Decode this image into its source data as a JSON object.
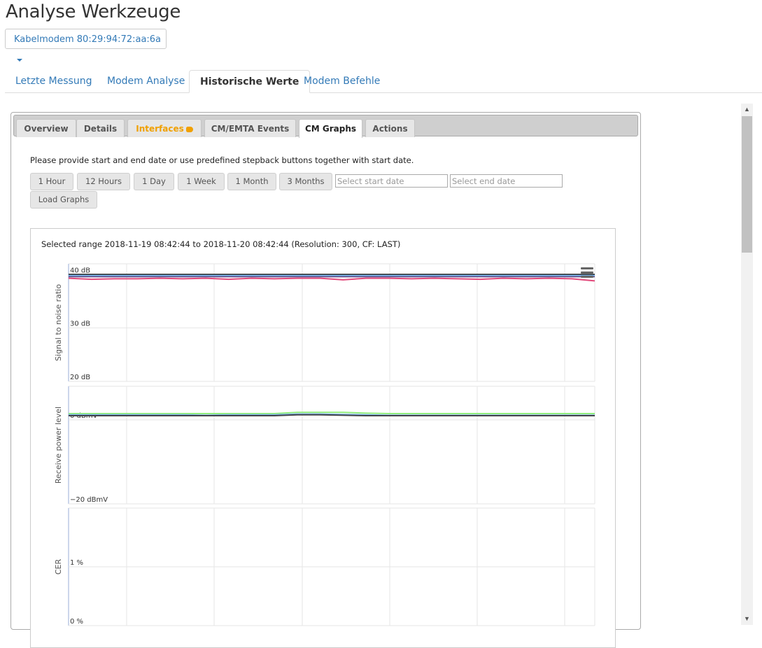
{
  "page": {
    "title": "Analyse Werkzeuge"
  },
  "device": {
    "label": "Kabelmodem 80:29:94:72:aa:6a"
  },
  "nav_tabs": [
    {
      "label": "Letzte Messung"
    },
    {
      "label": "Modem Analyse"
    },
    {
      "label": "Historische Werte",
      "active": true
    },
    {
      "label": "Modem Befehle"
    }
  ],
  "panel": {
    "tabs": [
      {
        "label": "Overview"
      },
      {
        "label": "Details"
      },
      {
        "label": "Interfaces",
        "icon": "warning-hand-icon"
      },
      {
        "label": "CM/EMTA Events"
      },
      {
        "label": "CM Graphs",
        "active": true
      },
      {
        "label": "Actions"
      }
    ],
    "instructions": "Please provide start and end date or use predefined stepback buttons together with start date.",
    "stepback_buttons": [
      "1 Hour",
      "12 Hours",
      "1 Day",
      "1 Week",
      "1 Month",
      "3 Months"
    ],
    "start_placeholder": "Select start date",
    "end_placeholder": "Select end date",
    "load_button": "Load Graphs"
  },
  "graph": {
    "range_text": "Selected range 2018-11-19 08:42:44 to 2018-11-20 08:42:44 (Resolution: 300, CF: LAST)",
    "menu_icon": "hamburger-menu-icon"
  },
  "chart_data": [
    {
      "type": "line",
      "ylabel": "Signal to noise ratio",
      "ytick_labels": [
        "40 dB",
        "30 dB",
        "20 dB"
      ],
      "yticks": [
        40,
        30,
        20
      ],
      "ylim": [
        20,
        42
      ],
      "x": "24 samples over 2018-11-19 08:42:44 to 2018-11-20 08:42:44",
      "series": [
        {
          "color": "#e2487a",
          "values": [
            39.3,
            39.1,
            39.2,
            39.2,
            39.3,
            39.2,
            39.3,
            39.1,
            39.3,
            39.2,
            39.3,
            39.3,
            39.0,
            39.3,
            39.3,
            39.2,
            39.3,
            39.2,
            39.1,
            39.3,
            39.2,
            39.3,
            39.2,
            38.8
          ]
        },
        {
          "color": "#5a3a7a",
          "values": [
            39.6,
            39.6,
            39.6,
            39.6,
            39.6,
            39.6,
            39.6,
            39.6,
            39.6,
            39.6,
            39.6,
            39.6,
            39.6,
            39.6,
            39.6,
            39.6,
            39.6,
            39.6,
            39.6,
            39.6,
            39.6,
            39.6,
            39.6,
            39.6
          ]
        },
        {
          "color": "#222222",
          "values": [
            40.0,
            40.0,
            40.0,
            40.0,
            40.0,
            40.0,
            40.0,
            40.0,
            40.0,
            40.0,
            40.0,
            40.0,
            40.0,
            40.0,
            40.0,
            40.0,
            40.0,
            40.0,
            40.0,
            40.0,
            40.0,
            40.0,
            40.0,
            40.0
          ]
        },
        {
          "color": "#7cb5ec",
          "values": [
            39.8,
            39.8,
            39.8,
            39.8,
            39.8,
            39.8,
            39.8,
            39.8,
            39.8,
            39.8,
            39.8,
            39.8,
            39.8,
            39.8,
            39.8,
            39.8,
            39.8,
            39.8,
            39.8,
            39.8,
            39.8,
            39.8,
            39.8,
            39.8
          ]
        }
      ]
    },
    {
      "type": "line",
      "ylabel": "Receive power level",
      "ytick_labels": [
        "0 dBmV",
        "−20 dBmV"
      ],
      "yticks": [
        0,
        -20
      ],
      "ylim": [
        -20,
        8
      ],
      "series": [
        {
          "color": "#90ed7d",
          "values": [
            1.5,
            1.5,
            1.5,
            1.5,
            1.5,
            1.5,
            1.5,
            1.5,
            1.5,
            1.5,
            1.8,
            1.8,
            1.8,
            1.6,
            1.5,
            1.5,
            1.5,
            1.5,
            1.5,
            1.5,
            1.5,
            1.5,
            1.5,
            1.5
          ]
        },
        {
          "color": "#7cb5ec",
          "values": [
            1.2,
            1.2,
            1.2,
            1.2,
            1.2,
            1.2,
            1.1,
            1.2,
            1.2,
            1.2,
            1.4,
            1.4,
            1.3,
            1.2,
            1.1,
            1.1,
            1.1,
            1.1,
            1.1,
            1.1,
            1.1,
            1.1,
            1.1,
            1.1
          ]
        },
        {
          "color": "#434348",
          "values": [
            1.0,
            1.0,
            1.0,
            1.0,
            1.0,
            1.0,
            1.0,
            1.0,
            1.0,
            1.0,
            1.2,
            1.2,
            1.1,
            1.0,
            1.0,
            1.0,
            1.0,
            1.0,
            1.0,
            1.0,
            1.0,
            1.0,
            1.0,
            1.0
          ]
        }
      ]
    },
    {
      "type": "line",
      "ylabel": "CER",
      "ytick_labels": [
        "1 %",
        "0 %"
      ],
      "yticks": [
        1,
        0
      ],
      "ylim": [
        0,
        2
      ],
      "series": []
    }
  ]
}
